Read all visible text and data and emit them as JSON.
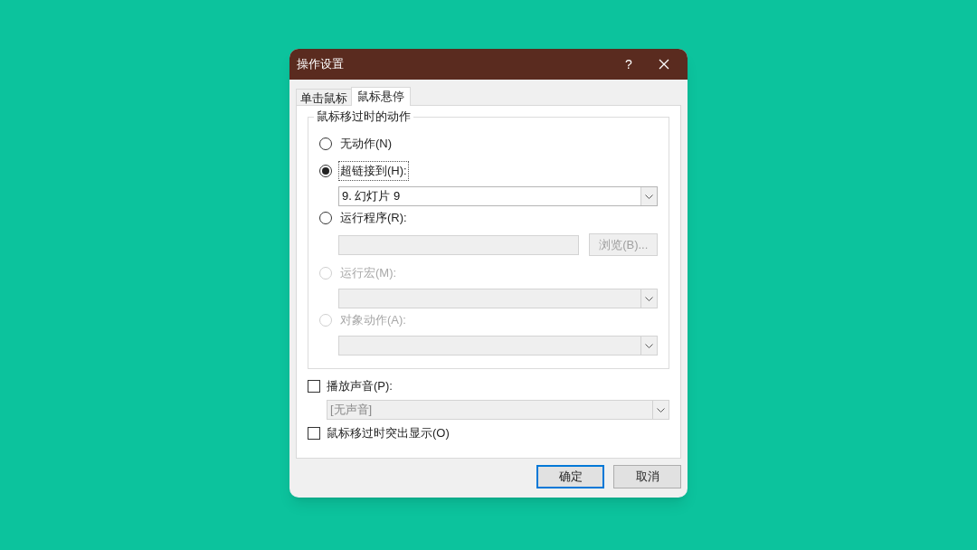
{
  "window": {
    "title": "操作设置",
    "help": "?"
  },
  "tabs": [
    {
      "label": "单击鼠标",
      "selected": false
    },
    {
      "label": "鼠标悬停",
      "selected": true
    }
  ],
  "group": {
    "title": "鼠标移过时的动作",
    "options": [
      {
        "label": "无动作(N)",
        "selected": false,
        "disabled": false,
        "focused": false
      },
      {
        "label": "超链接到(H):",
        "selected": true,
        "disabled": false,
        "focused": true,
        "field": {
          "kind": "dropdown",
          "value": "9. 幻灯片 9",
          "disabled": false
        }
      },
      {
        "label": "运行程序(R):",
        "selected": false,
        "disabled": false,
        "focused": false,
        "field": {
          "kind": "text",
          "disabled": true
        },
        "button": {
          "label": "浏览(B)...",
          "disabled": true
        }
      },
      {
        "label": "运行宏(M):",
        "selected": false,
        "disabled": true,
        "focused": false,
        "field": {
          "kind": "dropdown",
          "disabled": true
        }
      },
      {
        "label": "对象动作(A):",
        "selected": false,
        "disabled": true,
        "focused": false,
        "field": {
          "kind": "dropdown",
          "disabled": true
        }
      }
    ]
  },
  "checks": [
    {
      "label": "播放声音(P):",
      "checked": false,
      "field": {
        "kind": "dropdown",
        "value": "[无声音]",
        "disabled": true
      }
    },
    {
      "label": "鼠标移过时突出显示(O)",
      "checked": false
    }
  ],
  "buttons": [
    {
      "label": "确定",
      "default": true
    },
    {
      "label": "取消",
      "default": false
    }
  ]
}
